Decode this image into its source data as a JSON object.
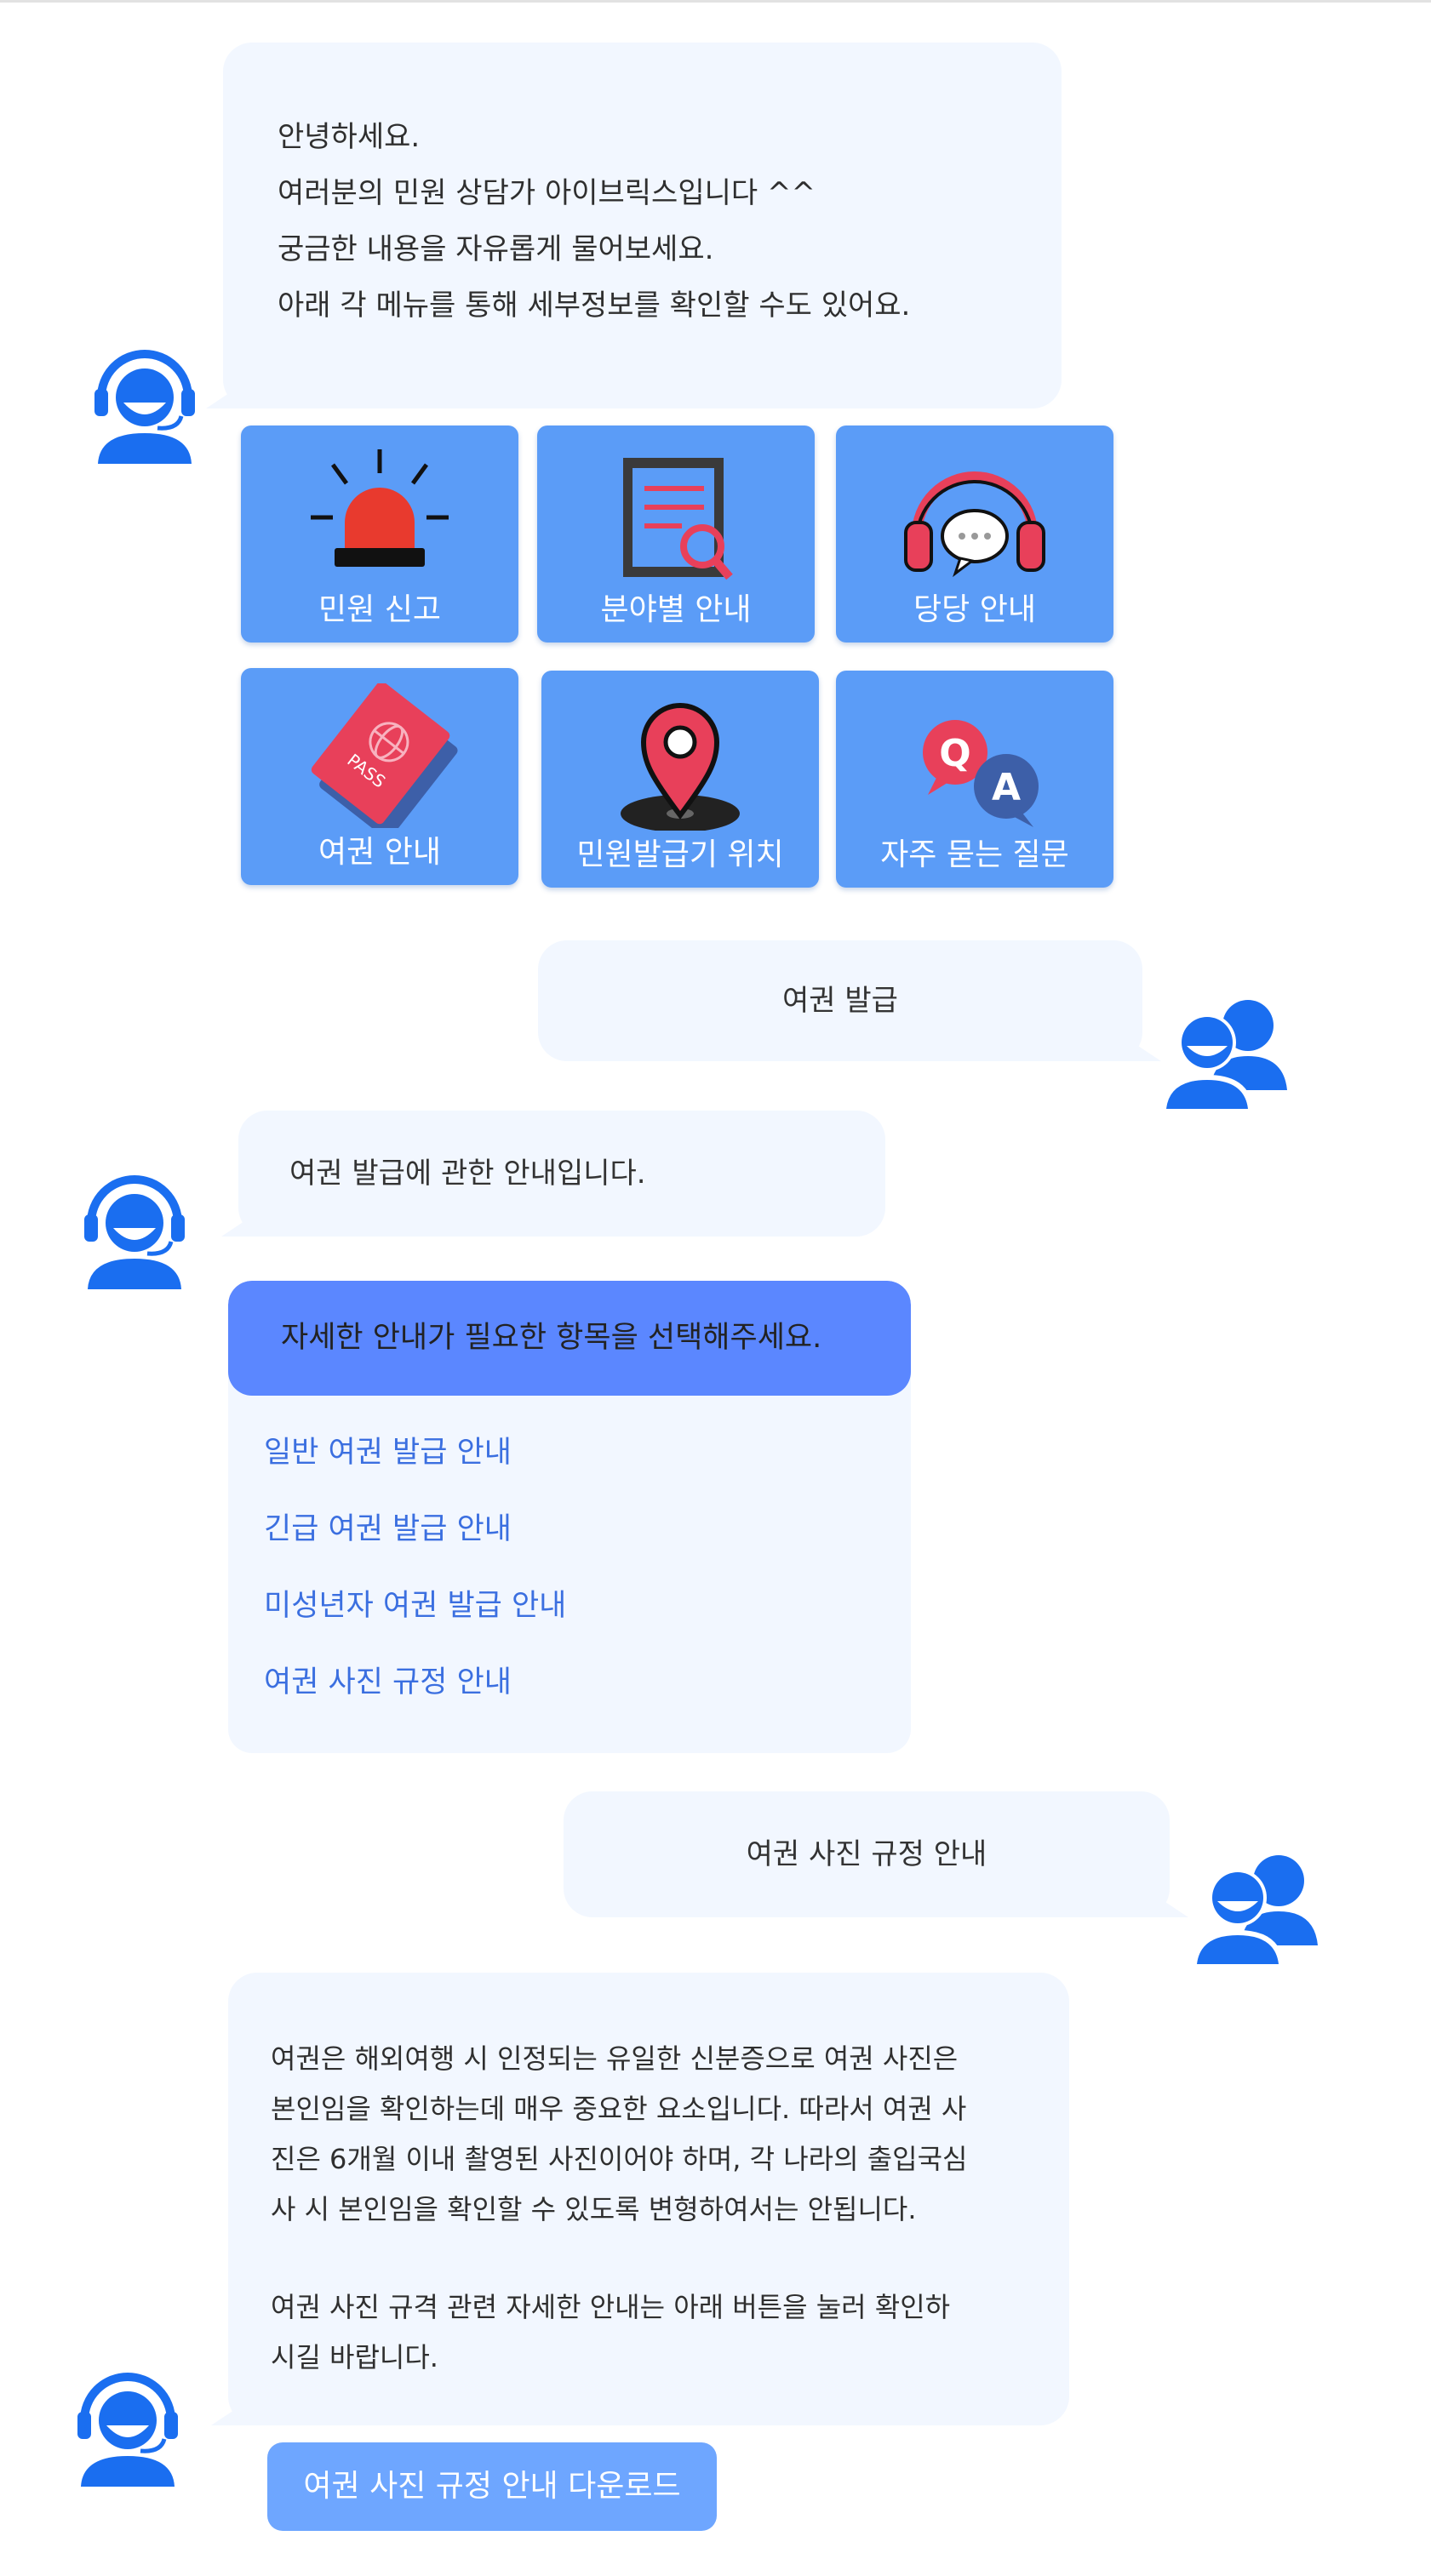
{
  "greeting": {
    "lines": [
      "안녕하세요.",
      "여러분의 민원 상담가 아이브릭스입니다 ^^",
      "궁금한 내용을 자유롭게 물어보세요.",
      "아래 각 메뉴를 통해 세부정보를 확인할 수도 있어요."
    ]
  },
  "menu": {
    "tiles": [
      {
        "label": "민원 신고",
        "icon": "siren-icon"
      },
      {
        "label": "분야별 안내",
        "icon": "document-search-icon"
      },
      {
        "label": "당당 안내",
        "icon": "headset-chat-icon"
      },
      {
        "label": "여권 안내",
        "icon": "passport-icon"
      },
      {
        "label": "민원발급기 위치",
        "icon": "map-pin-icon"
      },
      {
        "label": "자주 묻는 질문",
        "icon": "qa-bubbles-icon"
      }
    ]
  },
  "conversation": {
    "user_msg_1": "여권 발급",
    "bot_reply_1": "여권 발급에 관한 안내입니다.",
    "options_header": "자세한 안내가 필요한 항목을 선택해주세요.",
    "options": [
      "일반 여권 발급 안내",
      "긴급 여권 발급 안내",
      "미성년자 여권 발급 안내",
      "여권 사진 규정 안내"
    ],
    "user_msg_2": "여권 사진 규정 안내",
    "bot_reply_2_para1": [
      "여권은 해외여행 시 인정되는 유일한 신분증으로 여권 사진은",
      "본인임을 확인하는데 매우 중요한 요소입니다. 따라서 여권 사",
      "진은 6개월 이내 촬영된 사진이어야 하며, 각 나라의 출입국심",
      "사 시 본인임을 확인할 수 있도록 변형하여서는 안됩니다."
    ],
    "bot_reply_2_para2": [
      "여권 사진 규격 관련 자세한 안내는 아래 버튼을 눌러 확인하",
      "시길 바랍니다."
    ],
    "download_button": "여권 사진 규정 안내 다운로드"
  },
  "colors": {
    "bubble_bg": "#f2f7ff",
    "tile_bg": "#5b9cf7",
    "options_header_bg": "#5b87ff",
    "link_text": "#3b6fe0",
    "avatar_blue": "#1a6ef0"
  }
}
